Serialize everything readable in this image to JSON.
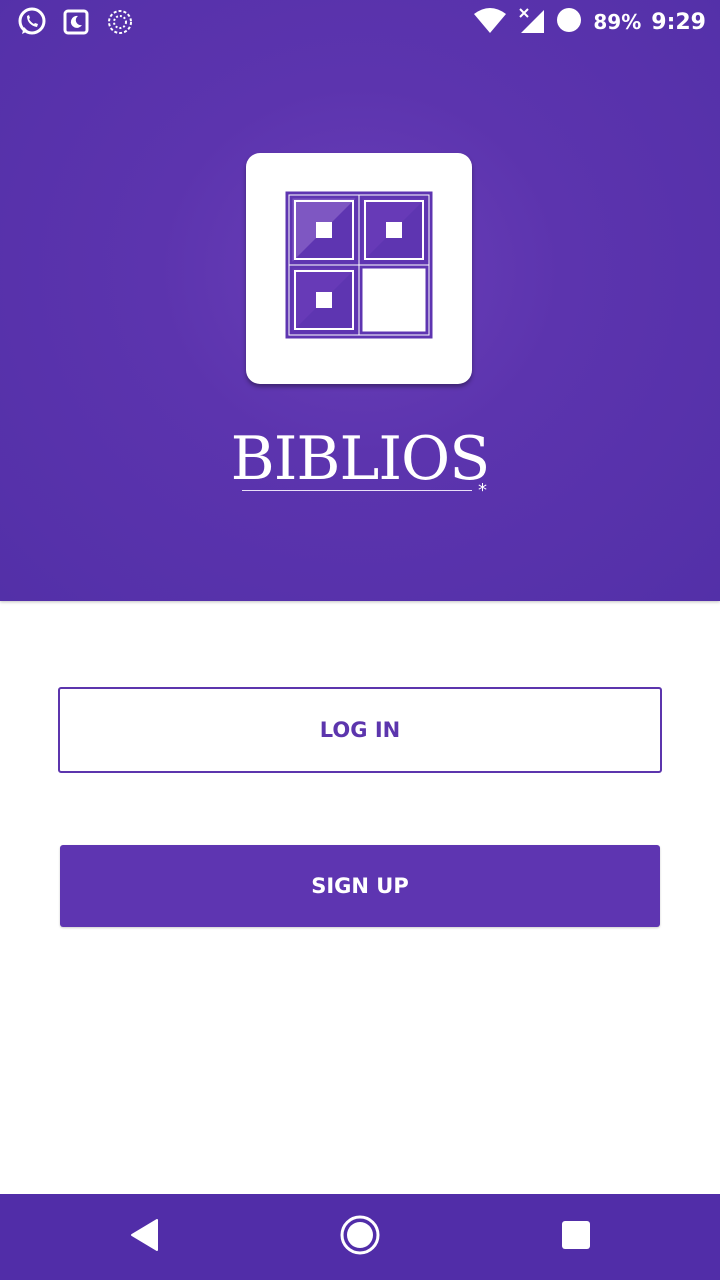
{
  "status_bar": {
    "icons_left": [
      "whatsapp-icon",
      "night-mode-icon",
      "sync-circle-icon"
    ],
    "icons_right": [
      "wifi-icon",
      "cellular-no-signal-icon",
      "dnd-circle-icon"
    ],
    "battery": "89%",
    "time": "9:29"
  },
  "brand": {
    "name": "BIBLIOS",
    "mark": "*"
  },
  "buttons": {
    "login": "LOG IN",
    "signup": "SIGN UP"
  },
  "nav_bar": {
    "icons": [
      "back-icon",
      "home-icon",
      "recents-icon"
    ]
  },
  "colors": {
    "primary": "#5e35b1",
    "header_dark": "#5330a8",
    "nav": "#512da8",
    "white": "#ffffff"
  }
}
